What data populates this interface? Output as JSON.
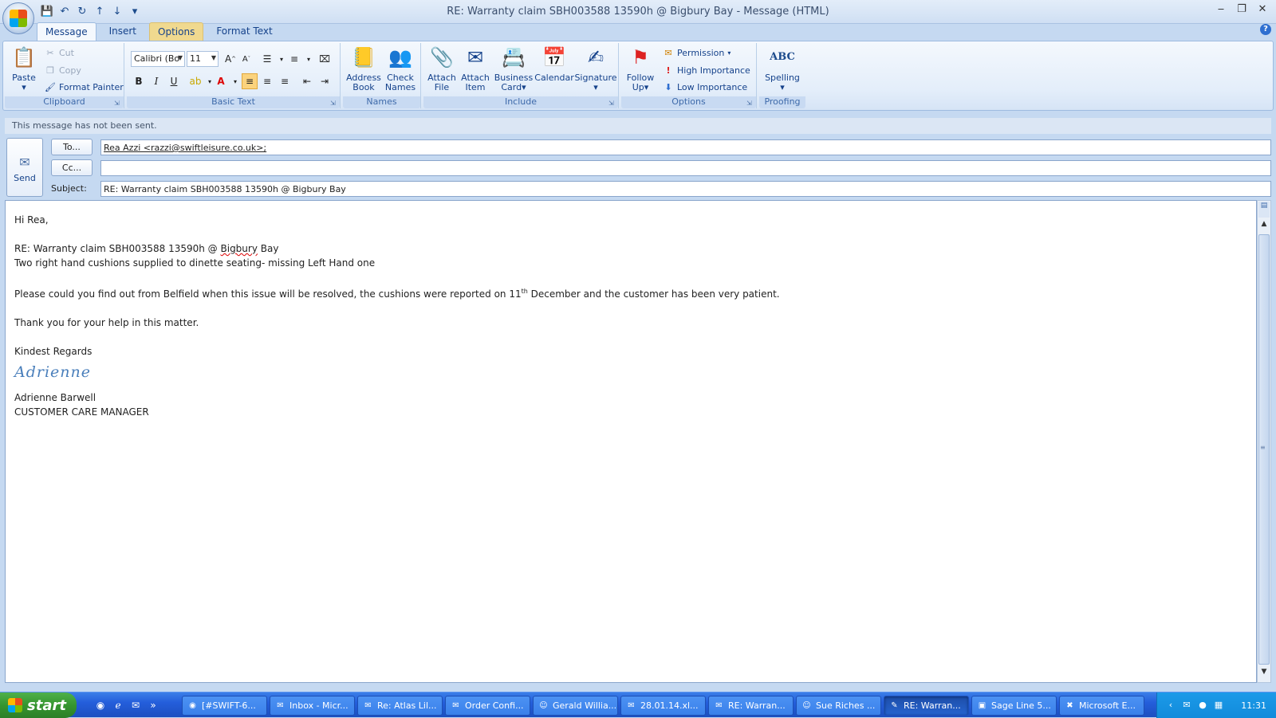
{
  "window": {
    "title": "RE: Warranty claim SBH003588 13590h @ Bigbury Bay - Message (HTML)",
    "controls": [
      "‒",
      "❐",
      "✕"
    ]
  },
  "ribbon_tabs": [
    "Message",
    "Insert",
    "Options",
    "Format Text"
  ],
  "clipboard": {
    "paste": "Paste",
    "cut": "Cut",
    "copy": "Copy",
    "format_painter": "Format Painter",
    "label": "Clipboard"
  },
  "basic_text": {
    "font": "Calibri (Bo",
    "size": "11",
    "label": "Basic Text",
    "bold": "B",
    "italic": "I",
    "underline": "U"
  },
  "names": {
    "address_book_1": "Address",
    "address_book_2": "Book",
    "check_names_1": "Check",
    "check_names_2": "Names",
    "label": "Names"
  },
  "include": {
    "attach_file_1": "Attach",
    "attach_file_2": "File",
    "attach_item_1": "Attach",
    "attach_item_2": "Item",
    "business_card_1": "Business",
    "business_card_2": "Card",
    "calendar": "Calendar",
    "signature": "Signature",
    "label": "Include"
  },
  "options": {
    "follow_up_1": "Follow",
    "follow_up_2": "Up",
    "permission": "Permission",
    "high_importance": "High Importance",
    "low_importance": "Low Importance",
    "label": "Options"
  },
  "proofing": {
    "spelling_icon": "ABC",
    "spelling": "Spelling",
    "label": "Proofing"
  },
  "infobar": "This message has not been sent.",
  "header": {
    "send": "Send",
    "to_button": "To...",
    "cc_button": "Cc...",
    "subject_label": "Subject:",
    "to_value": "Rea Azzi <razzi@swiftleisure.co.uk>;",
    "cc_value": "",
    "subject_value": "RE: Warranty claim SBH003588 13590h @ Bigbury Bay"
  },
  "body": {
    "greeting": "Hi Rea,",
    "line1_prefix": "RE: Warranty claim SBH003588 13590h @ ",
    "line1_squiggle": "Bigbury",
    "line1_suffix": " Bay",
    "line2": "Two right hand cushions supplied to dinette seating- missing Left Hand one",
    "para_prefix": "Please could you find out from Belfield when this issue will be resolved, the cushions were reported on 11",
    "para_sup": "th",
    "para_suffix": " December and the customer has been very patient.",
    "thanks": "Thank you for your help in this matter.",
    "closing": "Kindest Regards",
    "signature_script": "Adrienne",
    "sig_name": "Adrienne Barwell",
    "sig_title": "CUSTOMER CARE MANAGER"
  },
  "taskbar": {
    "start": "start",
    "tasks": [
      "[#SWIFT-6...",
      "Inbox - Micr...",
      "Re: Atlas Lil...",
      "Order Confi...",
      "Gerald Willia...",
      "28.01.14.xl...",
      "RE: Warran...",
      "Sue Riches ...",
      "RE: Warran...",
      "Sage Line 5...",
      "Microsoft E..."
    ],
    "clock": "11:31"
  }
}
